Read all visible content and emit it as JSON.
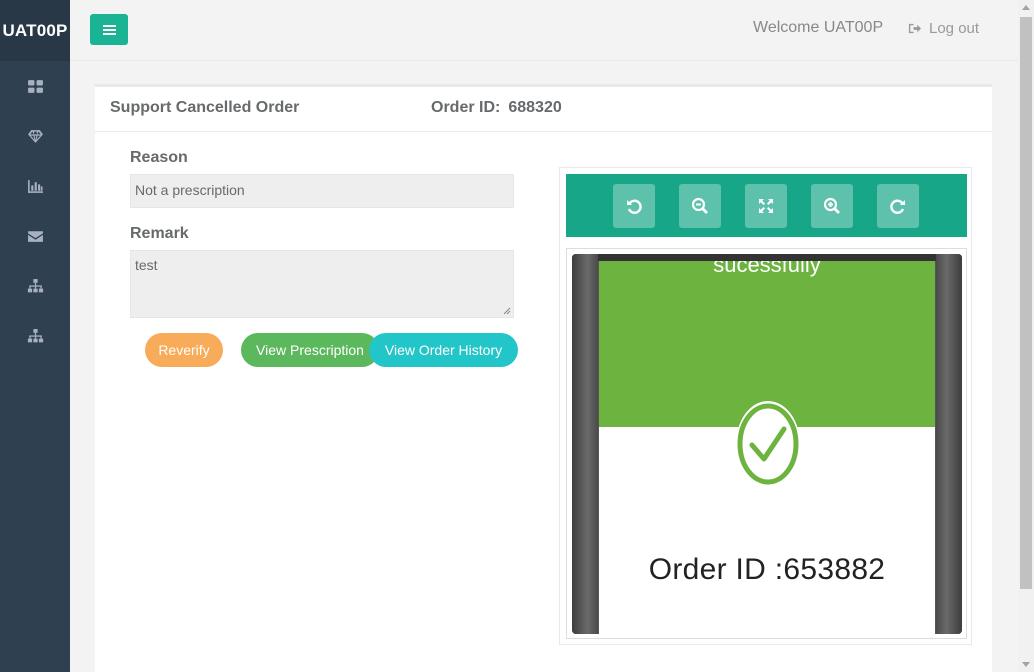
{
  "app": {
    "brand": "UAT00P"
  },
  "sidebar": {
    "items": [
      {
        "icon": "dashboard-icon"
      },
      {
        "icon": "diamond-icon"
      },
      {
        "icon": "bar-chart-icon"
      },
      {
        "icon": "envelope-icon"
      },
      {
        "icon": "sitemap-icon"
      },
      {
        "icon": "sitemap-icon"
      }
    ]
  },
  "topbar": {
    "welcome": "Welcome UAT00P",
    "logout": "Log out"
  },
  "panel": {
    "title": "Support Cancelled Order",
    "order_id_label": "Order ID:",
    "order_id_value": "688320"
  },
  "form": {
    "reason_label": "Reason",
    "reason_value": "Not a prescription",
    "remark_label": "Remark",
    "remark_value": "test"
  },
  "buttons": {
    "reverify": "Reverify",
    "view_prescription": "View Prescription",
    "view_order_history": "View Order History"
  },
  "viewer": {
    "toolbar": [
      "rotate-left-icon",
      "zoom-out-icon",
      "fit-screen-icon",
      "zoom-in-icon",
      "rotate-right-icon"
    ],
    "image": {
      "header_text": "sucessfully",
      "order_text": "Order ID :653882"
    }
  },
  "colors": {
    "sidebar": "#2f4050",
    "accent": "#1ab394",
    "reverify": "#f8ac59",
    "prescription": "#5cb85c",
    "history": "#23c6c8",
    "success_green": "#6db33f"
  }
}
